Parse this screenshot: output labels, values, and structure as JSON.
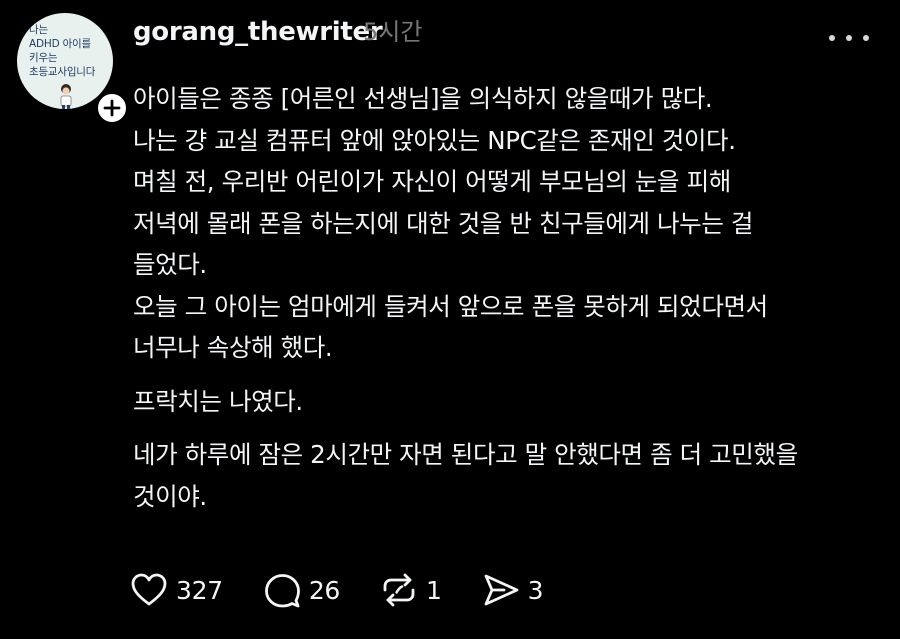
{
  "post": {
    "author": {
      "username": "gorang_thewriter",
      "avatar_text": "나는\nADHD 아이를\n키우는\n초등교사입니다",
      "follow_icon": "plus-icon"
    },
    "timestamp": "5시간",
    "more_icon": "more-horizontal-icon",
    "paragraphs": [
      {
        "lines": [
          "아이들은 종종 [어른인 선생님]을 의식하지 않을때가 많다.",
          "나는 걍 교실 컴퓨터 앞에 앉아있는 NPC같은 존재인 것이다.",
          "며칠 전, 우리반 어린이가 자신이 어떻게 부모님의 눈을 피해",
          "저녁에 몰래 폰을 하는지에 대한 것을 반 친구들에게 나누는 걸",
          "들었다.",
          "오늘 그 아이는 엄마에게 들켜서 앞으로 폰을 못하게 되었다면서",
          "너무나 속상해 했다."
        ]
      },
      {
        "lines": [
          "프락치는 나였다."
        ]
      },
      {
        "lines": [
          "네가 하루에 잠은 2시간만 자면 된다고 말 안했다면 좀 더 고민했을",
          "것이야."
        ]
      }
    ],
    "actions": {
      "like": {
        "icon": "heart-icon",
        "count": "327"
      },
      "reply": {
        "icon": "comment-icon",
        "count": "26"
      },
      "repost": {
        "icon": "repost-icon",
        "count": "1"
      },
      "share": {
        "icon": "send-icon",
        "count": "3"
      }
    }
  },
  "colors": {
    "background": "#000000",
    "text": "#f3f5f7",
    "muted": "#777777"
  }
}
